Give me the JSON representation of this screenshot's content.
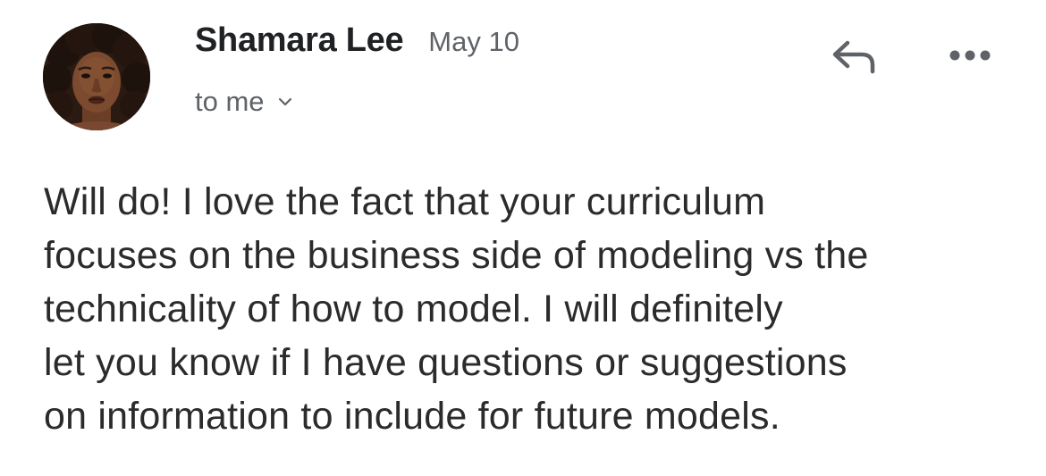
{
  "email": {
    "sender_name": "Shamara Lee",
    "date": "May 10",
    "recipient": "to me",
    "avatar_icon": "avatar-photo",
    "actions": {
      "reply_icon": "reply-icon",
      "more_icon": "more-options-icon"
    },
    "body_lines": [
      "Will do! I love the fact that your curriculum",
      "focuses on the business side of modeling vs the",
      "technicality of how to model. I will definitely",
      "let you know if I have questions or suggestions",
      "on information to include for future models."
    ]
  },
  "colors": {
    "text_primary": "#202124",
    "text_secondary": "#5f6368",
    "body_text": "#2b2b2b",
    "background": "#ffffff"
  }
}
